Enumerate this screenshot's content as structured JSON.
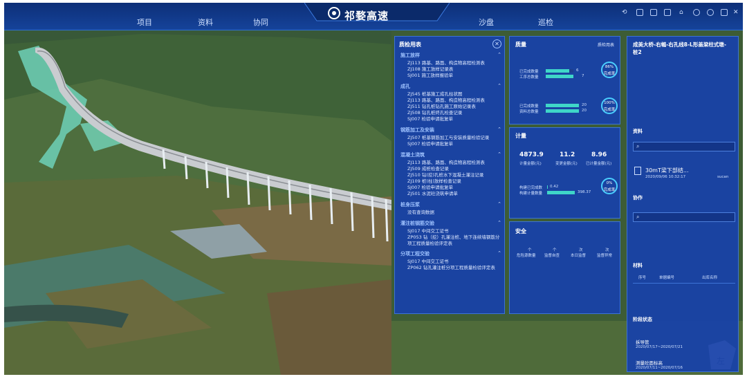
{
  "nav": {
    "items": [
      "项目",
      "资料",
      "协同",
      "沙盘",
      "巡检"
    ],
    "app_title": "祁婺高速"
  },
  "quality_table": {
    "title": "质检用表",
    "sections": [
      {
        "name": "施工放样",
        "items": [
          "ZJ113 路基、路面、构造物高程检测表",
          "ZJ108 施工放样记录表",
          "SJ001 施工放样报验单"
        ]
      },
      {
        "name": "成孔",
        "items": [
          "ZJ545 桩基施工成孔柱状图",
          "ZJ113 路基、路面、构造物高程检测表",
          "ZJ511 钻孔桩钻孔施工原始记录表",
          "ZJ508 钻孔桩终孔检查记录",
          "SJ007 检验申请批复单"
        ]
      },
      {
        "name": "钢筋加工及安装",
        "items": [
          "ZJ507 桩基钢筋加工与安装质量检验记录",
          "SJ007 检验申请批复单"
        ]
      },
      {
        "name": "混凝土浇筑",
        "items": [
          "ZJ113 路基、路面、构造物高程检测表",
          "ZJ509 成桩检查记录",
          "ZJ510 钻(挖)孔桩水下混凝土灌注记录",
          "ZJ109 桩(柱)放样检查记录",
          "SJ007 检验申请批复单",
          "ZJ501 水泥砼浇筑申请单"
        ]
      },
      {
        "name": "桩身压浆",
        "items": [
          "没有查询数据"
        ]
      },
      {
        "name": "灌注桩钢筋交验",
        "items": [
          "SJ017 中间交工证书",
          "ZP053 钻（挖）孔灌注桩、地下连续墙钢筋分项工程质量检验评定表"
        ]
      },
      {
        "name": "分项工程交验",
        "items": [
          "SJ017 中间交工证书",
          "ZP062 钻孔灌注桩分项工程质量检验评定表"
        ]
      }
    ]
  },
  "quality": {
    "title": "质量",
    "link": "质检用表",
    "group1": {
      "rows": [
        {
          "label": "已完成数量",
          "value": "6",
          "fill": 0.86
        },
        {
          "label": "工序总数量",
          "value": "7",
          "fill": 1.0
        }
      ],
      "pct": "86%",
      "pct_label": "完成率"
    },
    "group2": {
      "rows": [
        {
          "label": "已完成数量",
          "value": "20",
          "fill": 1.0
        },
        {
          "label": "资料总数量",
          "value": "20",
          "fill": 1.0
        }
      ],
      "pct": "100%",
      "pct_label": "完成率"
    }
  },
  "measure": {
    "title": "计量",
    "stats": [
      {
        "value": "4873.9",
        "label": "计量金额(元)"
      },
      {
        "value": "11.2",
        "label": "变更金额(元)"
      },
      {
        "value": "8.96",
        "label": "已计量金额(元)"
      }
    ],
    "rows": [
      {
        "label": "构建已完成数",
        "value": "0.42",
        "fill": 0.02
      },
      {
        "label": "构建计量数量",
        "value": "398.37",
        "fill": 1.0
      }
    ],
    "pct": "0%",
    "pct_label": "完成率"
  },
  "safety": {
    "title": "安全",
    "stats": [
      {
        "value": "个",
        "label": "危险源数量"
      },
      {
        "value": "个",
        "label": "监督自查"
      },
      {
        "value": "次",
        "label": "本日监督"
      },
      {
        "value": "次",
        "label": "监督异常"
      }
    ]
  },
  "right": {
    "title": "成美大桥-右幅-右孔线8-L形盖梁柱式墩-桩2",
    "docs_label": "资料",
    "doc": {
      "name": "30mT梁下部结...",
      "date": "2020/09/06 10:32:17",
      "user": "sucan"
    },
    "collab_label": "协作",
    "material_label": "材料",
    "material_cols": [
      "序号",
      "单据编号",
      "出库名称"
    ],
    "stage_label": "阶段状态",
    "stages": [
      {
        "name": "拆导管",
        "date": "2020/07/17~2020/07/21"
      },
      {
        "name": "测量砼面标高",
        "date": "2020/07/11~2020/07/16"
      }
    ]
  }
}
